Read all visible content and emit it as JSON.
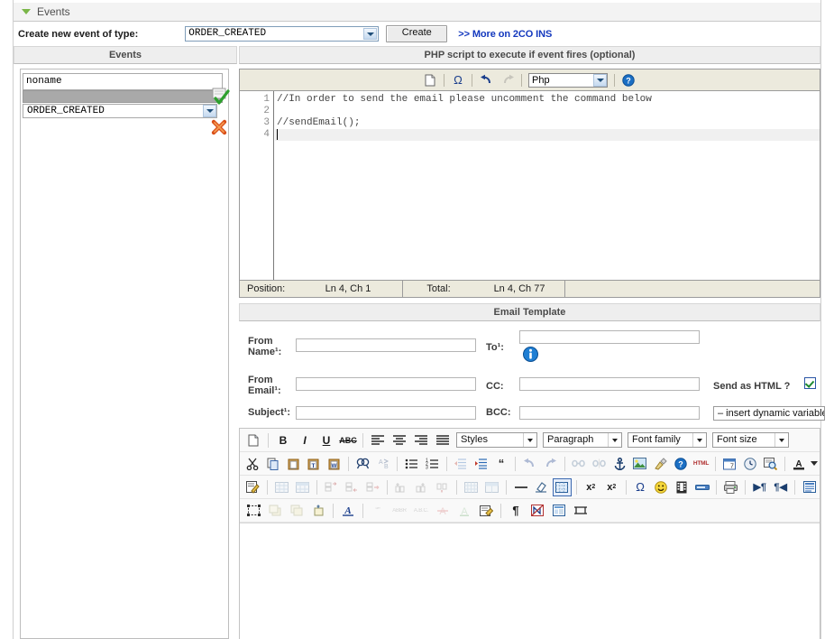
{
  "panel": {
    "title": "Events",
    "collapse_icon": "triangle-down-icon"
  },
  "create_row": {
    "label": "Create new event of type:",
    "event_type_value": "ORDER_CREATED",
    "create_button": "Create",
    "more_link": ">> More on 2CO INS"
  },
  "columns": {
    "left_header": "Events",
    "right_header": "PHP script to execute if event fires (optional)"
  },
  "events_panel": {
    "name_value": "noname",
    "name_placeholder": "noname",
    "selected_event": "ORDER_CREATED",
    "confirm_icon": "check-icon",
    "delete_icon": "delete-x-icon"
  },
  "code_editor": {
    "toolbar": {
      "new_doc": "new-document-icon",
      "special_char": "Ω",
      "undo": "undo-icon",
      "redo": "redo-icon",
      "language": "Php",
      "help": "help-icon"
    },
    "line_numbers": [
      "1",
      "2",
      "3",
      "4"
    ],
    "lines": [
      "//In order to send the email please uncomment the command below",
      "",
      "//sendEmail();",
      ""
    ],
    "status": {
      "position_label": "Position:",
      "position_value": "Ln 4, Ch 1",
      "total_label": "Total:",
      "total_value": "Ln 4, Ch 77"
    }
  },
  "email_template": {
    "header": "Email Template",
    "fields": {
      "from_name_label": "From Name¹:",
      "from_name_value": "",
      "from_email_label": "From Email¹:",
      "from_email_value": "",
      "subject_label": "Subject¹:",
      "subject_value": "",
      "to_label": "To¹:",
      "to_value": "",
      "cc_label": "CC:",
      "cc_value": "",
      "bcc_label": "BCC:",
      "bcc_value": ""
    },
    "info_icon": "info-icon",
    "send_as_html_label": "Send as HTML ?",
    "send_as_html_checked": true,
    "dynamic_variable_select": "– insert dynamic variable"
  },
  "editor_toolbar": {
    "row1": {
      "selects": {
        "styles": "Styles",
        "paragraph": "Paragraph",
        "font_family": "Font family",
        "font_size": "Font size"
      },
      "buttons": [
        "new-document-icon",
        "bold-icon",
        "italic-icon",
        "underline-icon",
        "strikethrough-icon",
        "align-left-icon",
        "align-center-icon",
        "align-right-icon",
        "align-justify-icon"
      ]
    },
    "row2": [
      "cut-icon",
      "copy-icon",
      "paste-icon",
      "paste-text-icon",
      "paste-word-icon",
      "find-icon",
      "find-replace-icon",
      "bullet-list-icon",
      "numbered-list-icon",
      "outdent-icon",
      "indent-icon",
      "blockquote-icon",
      "undo-icon",
      "redo-icon",
      "link-icon",
      "unlink-icon",
      "anchor-icon",
      "image-icon",
      "cleanup-icon",
      "help-icon",
      "html-source-icon",
      "calendar-icon",
      "time-icon",
      "preview-icon",
      "text-color-icon",
      "color-dropdown-icon"
    ],
    "row3": [
      "edit-css-icon",
      "table-insert-icon",
      "table-props-icon",
      "row-props-icon",
      "row-before-icon",
      "row-after-icon",
      "col-before-icon",
      "col-after-icon",
      "delete-col-icon",
      "split-cells-icon",
      "merge-cells-icon",
      "horizontal-rule-icon",
      "remove-format-icon",
      "visual-aid-icon",
      "subscript-icon",
      "superscript-icon",
      "special-char-icon",
      "emoticon-icon",
      "media-icon",
      "insert-layer-icon",
      "print-icon",
      "ltr-icon",
      "rtl-icon",
      "fullscreen-icon"
    ],
    "row4": [
      "select-layer-icon",
      "move-forward-icon",
      "move-backward-icon",
      "insert-layer-icon",
      "style-props-icon",
      "citation-icon",
      "abbr-icon",
      "acronym-icon",
      "del-icon",
      "ins-icon",
      "attributes-icon",
      "show-invisible-icon",
      "nonbreaking-icon",
      "template-icon",
      "pagebreak-icon"
    ]
  }
}
